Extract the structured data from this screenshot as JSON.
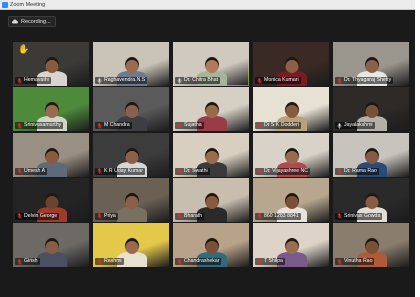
{
  "window": {
    "title": "Zoom Meeting"
  },
  "recording": {
    "label": "Recording..."
  },
  "participants": [
    {
      "name": "Hemavathi",
      "muted": true,
      "speaking": false,
      "bg": "#3b3a37",
      "skin": "#8a5a3c",
      "shirt": "#d9d4cf"
    },
    {
      "name": "Raghavendra.N.S",
      "muted": false,
      "speaking": false,
      "bg": "#c9c3b8",
      "skin": "#9a6b4c",
      "shirt": "#6e7b8f"
    },
    {
      "name": "Dr. Chitra Bhat",
      "muted": false,
      "speaking": true,
      "bg": "#cfc9c0",
      "skin": "#b07b5a",
      "shirt": "#a7b39a"
    },
    {
      "name": "Monica Kumari",
      "muted": true,
      "speaking": false,
      "bg": "#3a2a26",
      "skin": "#8d5f44",
      "shirt": "#7a1c24"
    },
    {
      "name": "Dr. Thyagaraj Shetty",
      "muted": true,
      "speaking": false,
      "bg": "#9a968d",
      "skin": "#8a6048",
      "shirt": "#e8e6e2"
    },
    {
      "name": "Srinivasamurthy",
      "muted": true,
      "speaking": false,
      "bg": "#4d8a3a",
      "skin": "#9a6c4e",
      "shirt": "#cfd8c8"
    },
    {
      "name": "M Chandra",
      "muted": true,
      "speaking": false,
      "bg": "#5a5a5a",
      "skin": "#8a6050",
      "shirt": "#3d3d44"
    },
    {
      "name": "Sujatha",
      "muted": true,
      "speaking": false,
      "bg": "#d6d0c4",
      "skin": "#9a6a4c",
      "shirt": "#9a3b4a"
    },
    {
      "name": "Dr S K Dodderi",
      "muted": true,
      "speaking": false,
      "bg": "#e7e1d3",
      "skin": "#8a5a40",
      "shirt": "#b9a27a"
    },
    {
      "name": "Jayalakshmi",
      "muted": false,
      "speaking": false,
      "bg": "#2d2a28",
      "skin": "#7a503a",
      "shirt": "#b3b0a8"
    },
    {
      "name": "Umesh A",
      "muted": true,
      "speaking": false,
      "bg": "#9a8f83",
      "skin": "#8a5a3e",
      "shirt": "#5d6a7a"
    },
    {
      "name": "K R Uday Kumar",
      "muted": true,
      "speaking": false,
      "bg": "#3c3c3c",
      "skin": "#8d6048",
      "shirt": "#d6d6d6"
    },
    {
      "name": "Dr. Swathi",
      "muted": true,
      "speaking": false,
      "bg": "#d8cfc0",
      "skin": "#9a6c4c",
      "shirt": "#3a3a3a"
    },
    {
      "name": "Dr. Vijayashree NC",
      "muted": true,
      "speaking": false,
      "bg": "#d9d2c8",
      "skin": "#9a6a50",
      "shirt": "#b2484f"
    },
    {
      "name": "Dr. Rama Rao",
      "muted": true,
      "speaking": false,
      "bg": "#c7c4bd",
      "skin": "#845a44",
      "shirt": "#2a4a7a"
    },
    {
      "name": "Delvin George",
      "muted": true,
      "speaking": false,
      "bg": "#242424",
      "skin": "#6a4430",
      "shirt": "#a03a2a"
    },
    {
      "name": "Priya",
      "muted": true,
      "speaking": false,
      "bg": "#6a6054",
      "skin": "#8a6048",
      "shirt": "#7a7060"
    },
    {
      "name": "Bharath",
      "muted": true,
      "speaking": false,
      "bg": "#c8beb0",
      "skin": "#8a5a40",
      "shirt": "#2a2a2a"
    },
    {
      "name": "860 1283 8841",
      "muted": true,
      "speaking": false,
      "bg": "#b7a78e",
      "skin": "#7a5038",
      "shirt": "#e8e4dc"
    },
    {
      "name": "Srinivas Gowda",
      "muted": true,
      "speaking": false,
      "bg": "#2a2a2a",
      "skin": "#8a5c44",
      "shirt": "#e0ddd6"
    },
    {
      "name": "Girish",
      "muted": true,
      "speaking": false,
      "bg": "#6d6a66",
      "skin": "#8a5e46",
      "shirt": "#4a5060"
    },
    {
      "name": "Rashmi",
      "muted": true,
      "speaking": false,
      "bg": "#e4c84a",
      "skin": "#9a6a4e",
      "shirt": "#e8e0d0"
    },
    {
      "name": "Chandrashekar",
      "muted": true,
      "speaking": false,
      "bg": "#b8a28a",
      "skin": "#7a5038",
      "shirt": "#2f6b7a"
    },
    {
      "name": "T Shilpa",
      "muted": true,
      "speaking": false,
      "bg": "#ddd3c6",
      "skin": "#9a6c52",
      "shirt": "#7a5a8a"
    },
    {
      "name": "Vinutha Rao",
      "muted": true,
      "speaking": false,
      "bg": "#8a7d6e",
      "skin": "#7a5038",
      "shirt": "#b05a3a"
    }
  ]
}
